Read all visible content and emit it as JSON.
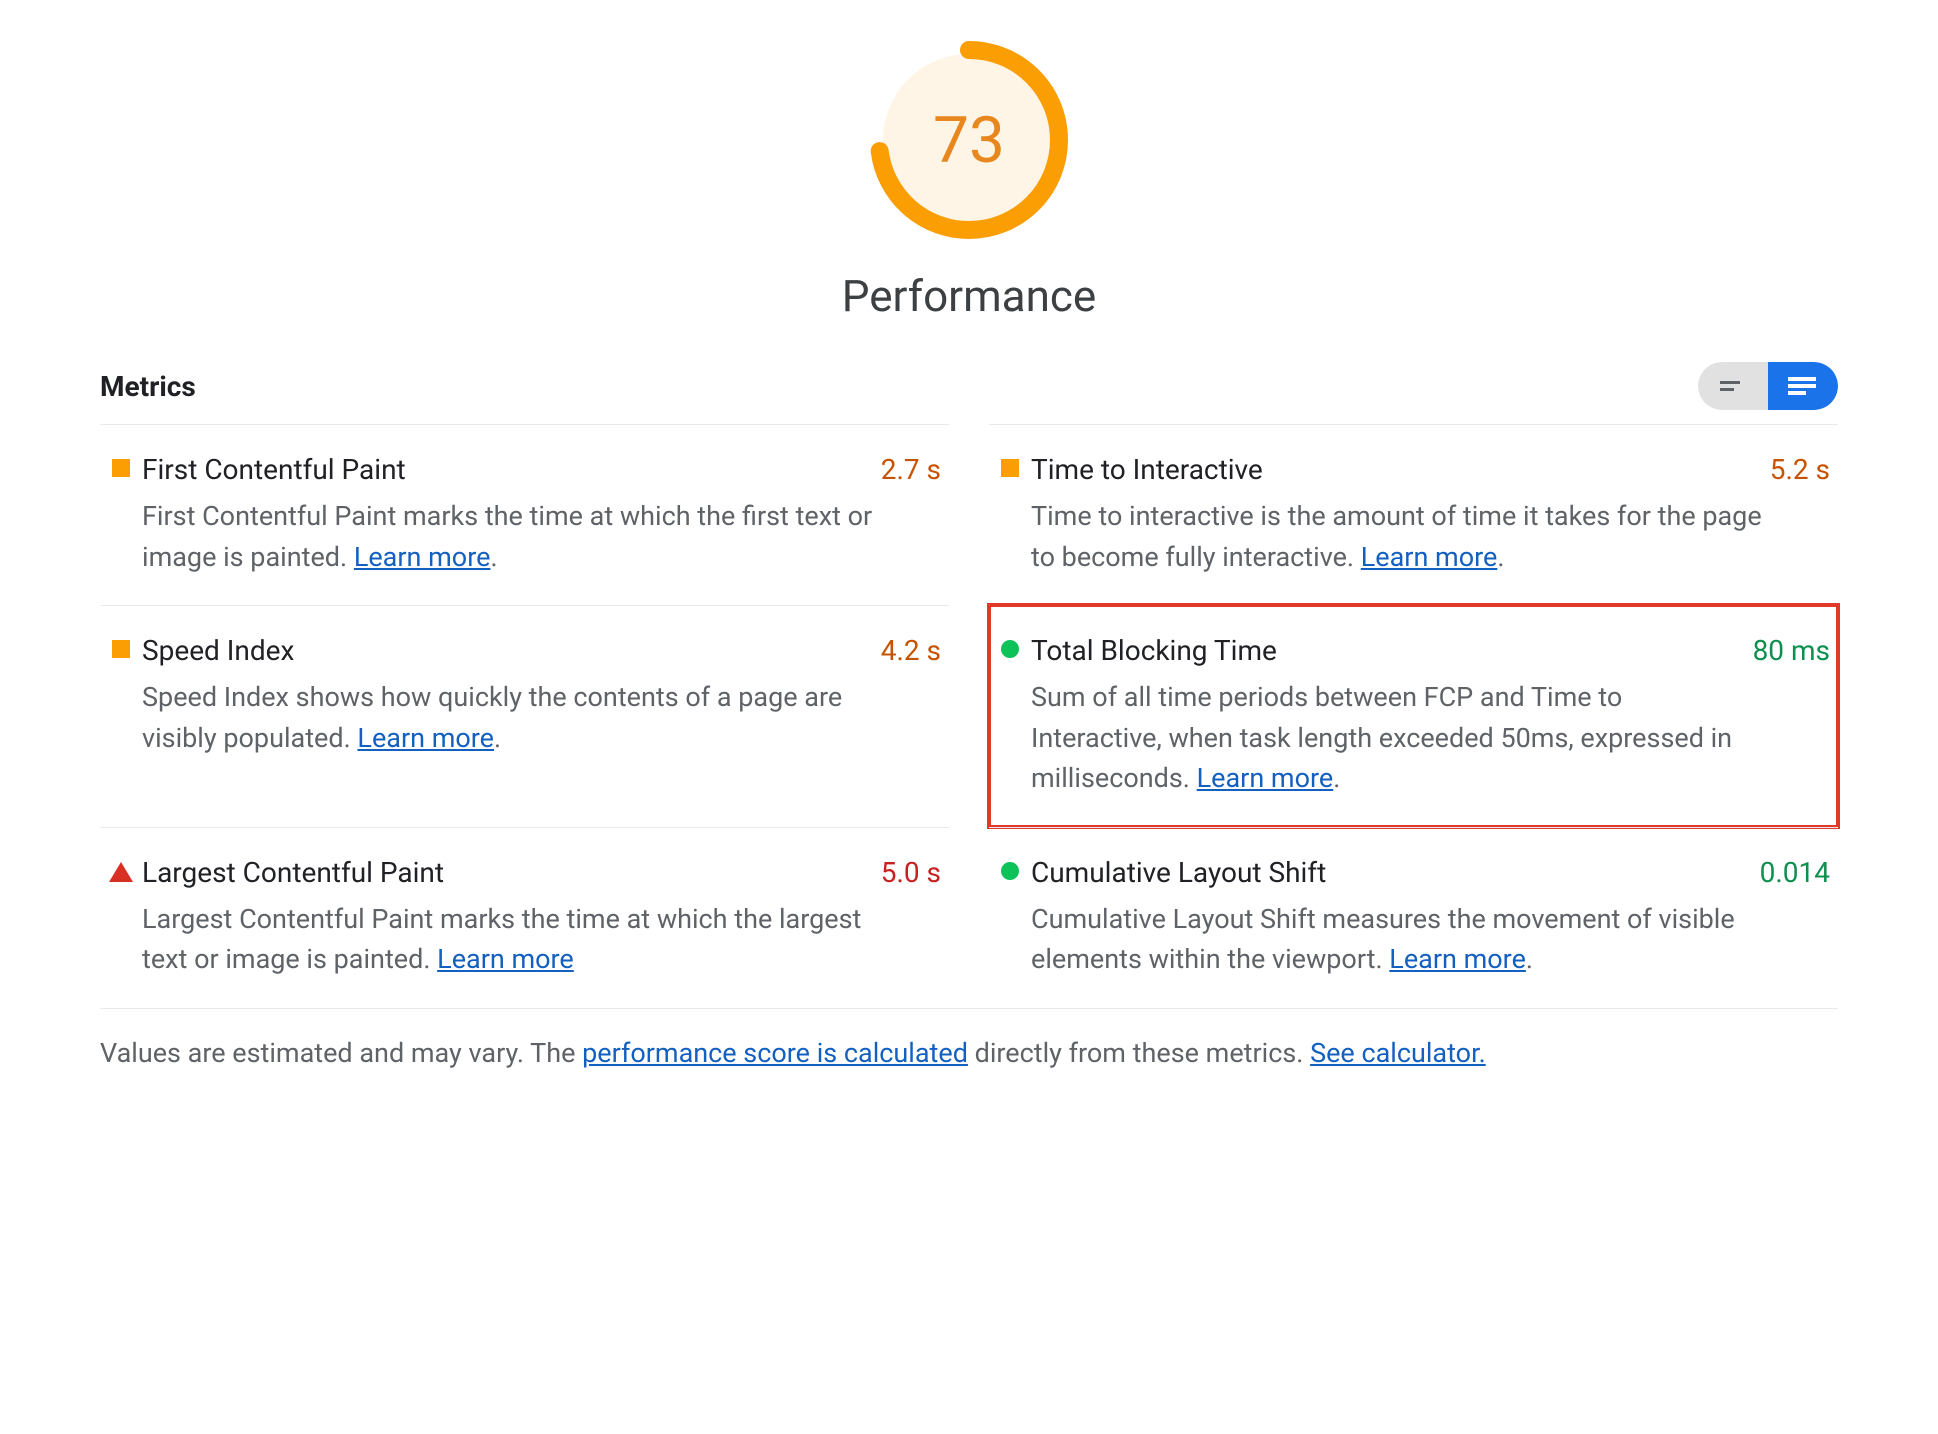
{
  "header": {
    "score": 73,
    "title": "Performance"
  },
  "section": {
    "heading": "Metrics",
    "toggle": {
      "compact": "compact-view",
      "expanded": "expanded-view"
    }
  },
  "learn_more_label": "Learn more",
  "metrics": {
    "fcp": {
      "status": "average",
      "title": "First Contentful Paint",
      "value": "2.7 s",
      "desc_pre": "First Contentful Paint marks the time at which the first text or image is painted. ",
      "desc_post": "."
    },
    "tti": {
      "status": "average",
      "title": "Time to Interactive",
      "value": "5.2 s",
      "desc_pre": "Time to interactive is the amount of time it takes for the page to become fully interactive. ",
      "desc_post": "."
    },
    "si": {
      "status": "average",
      "title": "Speed Index",
      "value": "4.2 s",
      "desc_pre": "Speed Index shows how quickly the contents of a page are visibly populated. ",
      "desc_post": "."
    },
    "tbt": {
      "status": "pass",
      "title": "Total Blocking Time",
      "value": "80 ms",
      "desc_pre": "Sum of all time periods between FCP and Time to Interactive, when task length exceeded 50ms, expressed in milliseconds. ",
      "desc_post": "."
    },
    "lcp": {
      "status": "fail",
      "title": "Largest Contentful Paint",
      "value": "5.0 s",
      "desc_pre": "Largest Contentful Paint marks the time at which the largest text or image is painted. ",
      "desc_post": ""
    },
    "cls": {
      "status": "pass",
      "title": "Cumulative Layout Shift",
      "value": "0.014",
      "desc_pre": "Cumulative Layout Shift measures the movement of visible elements within the viewport. ",
      "desc_post": "."
    }
  },
  "footnote": {
    "pre": "Values are estimated and may vary. The ",
    "link1": "performance score is calculated",
    "mid": " directly from these metrics. ",
    "link2": "See calculator."
  },
  "highlight_metric": "tbt"
}
